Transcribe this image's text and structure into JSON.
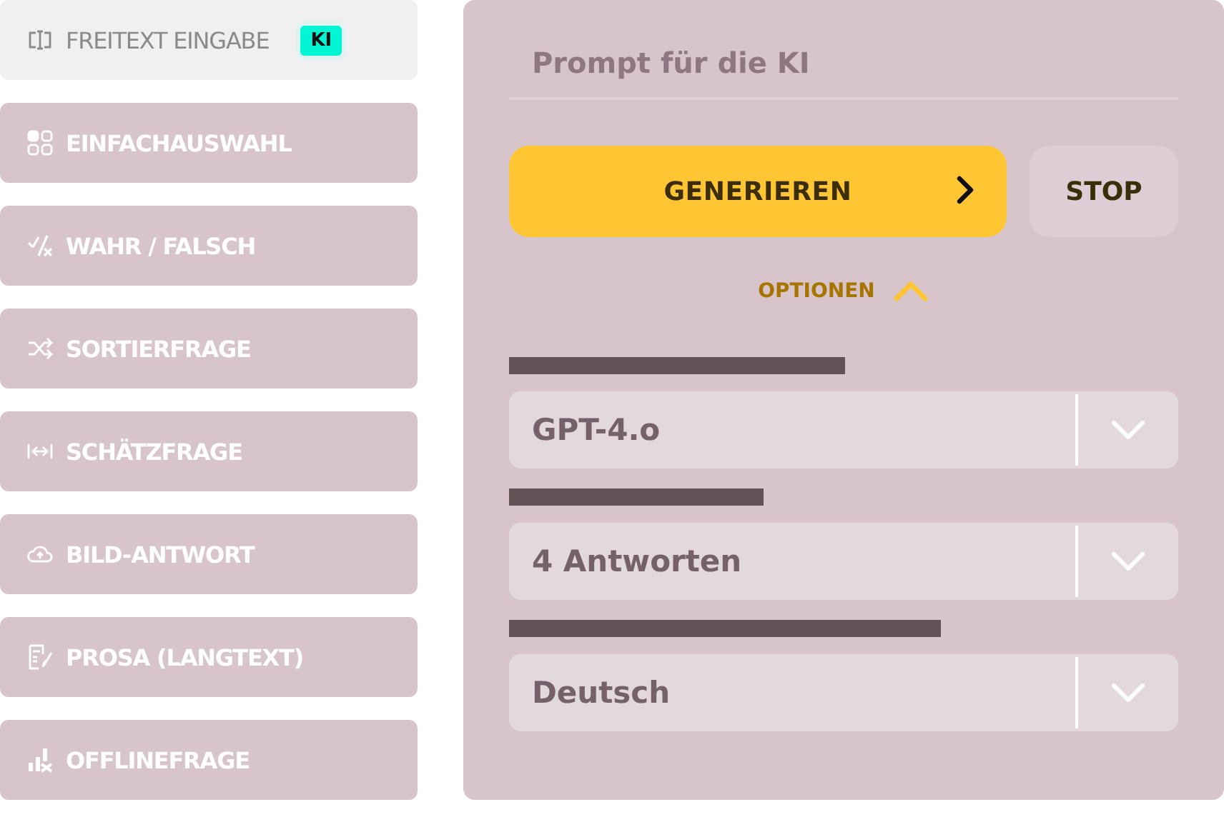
{
  "sidebar": {
    "items": [
      {
        "label": "FREITEXT EINGABE",
        "kind": "textcursor",
        "selected": true,
        "badge": "KI"
      },
      {
        "label": "EINFACHAUSWAHL",
        "kind": "grid",
        "selected": false
      },
      {
        "label": "WAHR / FALSCH",
        "kind": "checkx",
        "selected": false
      },
      {
        "label": "SORTIERFRAGE",
        "kind": "shuffle",
        "selected": false
      },
      {
        "label": "SCHÄTZFRAGE",
        "kind": "range",
        "selected": false
      },
      {
        "label": "BILD-ANTWORT",
        "kind": "cloud",
        "selected": false
      },
      {
        "label": "PROSA (LANGTEXT)",
        "kind": "pen",
        "selected": false
      },
      {
        "label": "OFFLINEFRAGE",
        "kind": "bars",
        "selected": false
      }
    ]
  },
  "prompt": {
    "placeholder": "Prompt für die KI"
  },
  "generate_button": {
    "label": "GENERIEREN"
  },
  "stop_button": {
    "label": "STOP"
  },
  "options": {
    "label": "OPTIONEN",
    "expanded": true
  },
  "selects": [
    {
      "value": "GPT-4.o"
    },
    {
      "value": "4 Antworten"
    },
    {
      "value": "Deutsch"
    }
  ]
}
